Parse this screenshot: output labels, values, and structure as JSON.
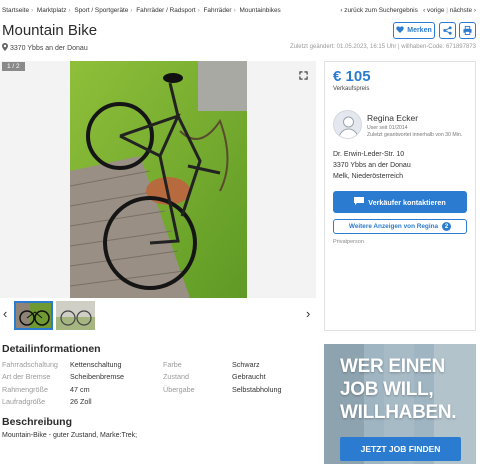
{
  "breadcrumbs": [
    "Startseite",
    "Marktplatz",
    "Sport / Sportgeräte",
    "Fahrräder / Radsport",
    "Fahrräder",
    "Mountainbikes"
  ],
  "back_link": "zurück zum Suchergebnis",
  "prev_link": "vorige",
  "next_link": "nächste",
  "listing": {
    "title": "Mountain Bike",
    "location": "3370 Ybbs an der Donau",
    "meta": "Zuletzt geändert: 01.05.2023, 16:15 Uhr | willhaben-Code: 671897873",
    "save_label": "Merken",
    "image_counter": "1 / 2",
    "price": "€ 105",
    "price_label": "Verkaufspreis"
  },
  "seller": {
    "name": "Regina Ecker",
    "since": "User seit 01/2014",
    "response": "Zuletzt geantwortet innerhalb von 30 Min.",
    "address": [
      "Dr. Erwin-Leder-Str. 10",
      "3370 Ybbs an der Donau",
      "Melk, Niederösterreich"
    ],
    "contact_label": "Verkäufer kontaktieren",
    "more_label": "Weitere Anzeigen von Regina",
    "more_count": "2",
    "type": "Privatperson"
  },
  "details": {
    "heading": "Detailinformationen",
    "left": [
      {
        "k": "Fahrradschaltung",
        "v": "Kettenschaltung"
      },
      {
        "k": "Art der Bremse",
        "v": "Scheibenbremse"
      },
      {
        "k": "Rahmengröße",
        "v": "47 cm"
      },
      {
        "k": "Laufradgröße",
        "v": "26 Zoll"
      }
    ],
    "right": [
      {
        "k": "Farbe",
        "v": "Schwarz"
      },
      {
        "k": "Zustand",
        "v": "Gebraucht"
      },
      {
        "k": "Übergabe",
        "v": "Selbstabholung"
      }
    ]
  },
  "description": {
    "heading": "Beschreibung",
    "text": "Mountain-Bike - guter Zustand, Marke:Trek;"
  },
  "ad": {
    "lines": [
      "WER EINEN",
      "JOB WILL,",
      "WILLHABEN."
    ],
    "button": "JETZT JOB FINDEN"
  },
  "colors": {
    "accent": "#2b7bd1",
    "ad_bg": "#9fb5c2"
  },
  "icons": [
    "map-pin-icon",
    "heart-icon",
    "share-icon",
    "print-icon",
    "expand-icon",
    "chevron-left-icon",
    "chevron-right-icon",
    "user-avatar-icon",
    "chat-icon"
  ]
}
